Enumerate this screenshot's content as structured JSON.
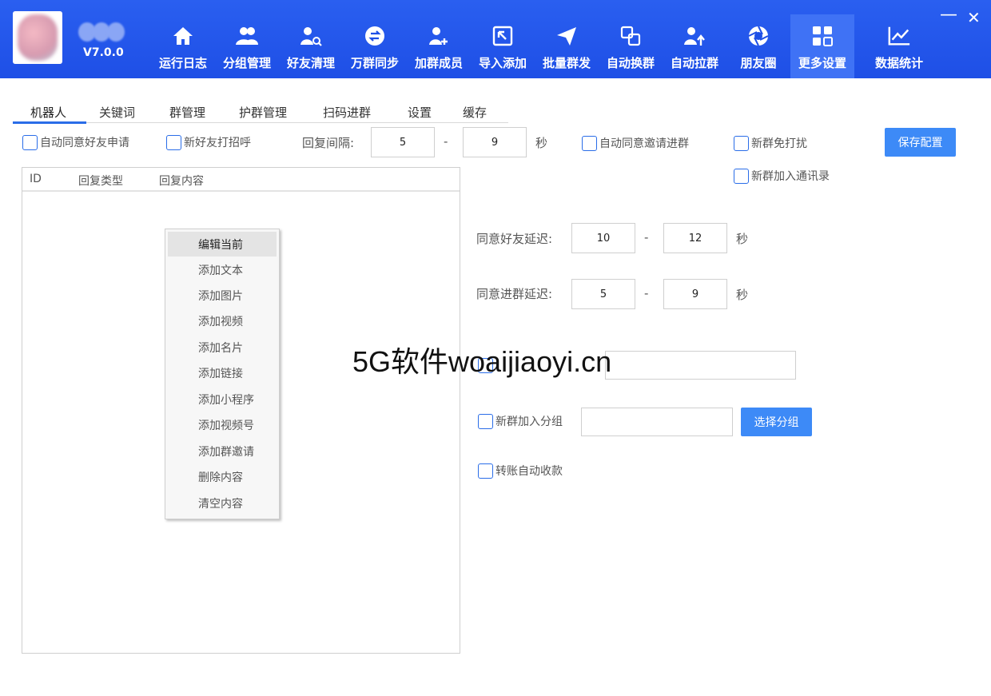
{
  "app": {
    "version": "V7.0.0",
    "minimize": "—",
    "close": "✕"
  },
  "nav": [
    {
      "label": "运行日志",
      "icon": "home-icon"
    },
    {
      "label": "分组管理",
      "icon": "users-icon"
    },
    {
      "label": "好友清理",
      "icon": "user-search-icon"
    },
    {
      "label": "万群同步",
      "icon": "sync-icon"
    },
    {
      "label": "加群成员",
      "icon": "user-add-icon"
    },
    {
      "label": "导入添加",
      "icon": "import-icon"
    },
    {
      "label": "批量群发",
      "icon": "send-icon"
    },
    {
      "label": "自动换群",
      "icon": "switch-icon"
    },
    {
      "label": "自动拉群",
      "icon": "user-up-icon"
    },
    {
      "label": "朋友圈",
      "icon": "aperture-icon"
    },
    {
      "label": "更多设置",
      "icon": "grid-icon",
      "active": true
    },
    {
      "label": "数据统计",
      "icon": "chart-icon"
    }
  ],
  "tabs": [
    "机器人",
    "关键词",
    "群管理",
    "护群管理",
    "扫码进群",
    "设置",
    "缓存"
  ],
  "settings": {
    "auto_accept_friend": "自动同意好友申请",
    "greet_new_friend": "新好友打招呼",
    "reply_interval_label": "回复间隔:",
    "reply_min": "5",
    "reply_max": "9",
    "dash": "-",
    "seconds": "秒",
    "auto_accept_group_invite": "自动同意邀请进群",
    "new_group_no_disturb": "新群免打扰",
    "save_button": "保存配置",
    "new_group_add_contacts": "新群加入通讯录",
    "accept_friend_delay_label": "同意好友延迟:",
    "friend_delay_min": "10",
    "friend_delay_max": "12",
    "accept_group_delay_label": "同意进群延迟:",
    "group_delay_min": "5",
    "group_delay_max": "9",
    "new_group_add_group_label": "新群加入分组",
    "select_group_button": "选择分组",
    "auto_receive_transfer": "转账自动收款"
  },
  "table": {
    "columns": [
      "ID",
      "回复类型",
      "回复内容"
    ]
  },
  "context_menu": [
    "编辑当前",
    "添加文本",
    "添加图片",
    "添加视频",
    "添加名片",
    "添加链接",
    "添加小程序",
    "添加视频号",
    "添加群邀请",
    "删除内容",
    "清空内容"
  ],
  "watermark": "5G软件woaijiaoyi.cn"
}
